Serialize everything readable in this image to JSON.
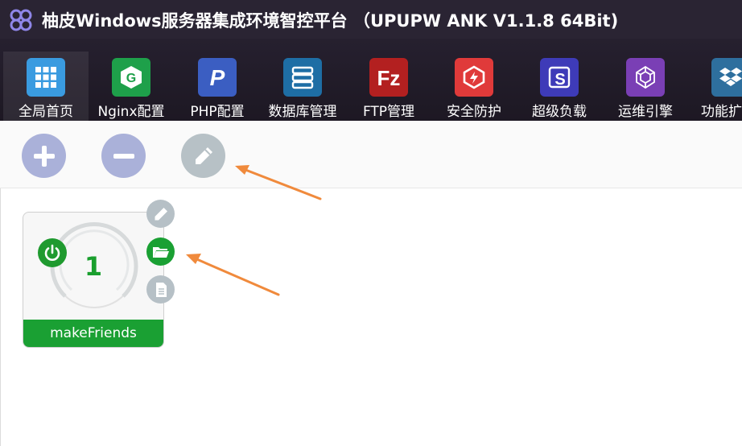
{
  "window": {
    "title": "柚皮Windows服务器集成环境智控平台 （UPUPW ANK V1.1.8 64Bit)"
  },
  "toolbar": {
    "items": [
      {
        "label": "全局首页",
        "icon": "grid-icon",
        "color": "#3a9be0"
      },
      {
        "label": "Nginx配置",
        "icon": "nginx-icon",
        "color": "#1ea04a"
      },
      {
        "label": "PHP配置",
        "icon": "php-icon",
        "color": "#3b5ec2"
      },
      {
        "label": "数据库管理",
        "icon": "database-icon",
        "color": "#1e6ea5"
      },
      {
        "label": "FTP管理",
        "icon": "filezilla-icon",
        "color": "#b32020"
      },
      {
        "label": "安全防护",
        "icon": "shield-icon",
        "color": "#e03a3a"
      },
      {
        "label": "超级负载",
        "icon": "load-icon",
        "color": "#3e3bb8"
      },
      {
        "label": "运维引擎",
        "icon": "engine-icon",
        "color": "#7a3fb5"
      },
      {
        "label": "功能扩",
        "icon": "dropbox-icon",
        "color": "#2e6f9e"
      }
    ]
  },
  "actions": {
    "add_icon": "plus-icon",
    "remove_icon": "minus-icon",
    "edit_icon": "pencil-icon"
  },
  "site_card": {
    "count": "1",
    "name": "makeFriends",
    "status_icon": "power-icon",
    "side_buttons": [
      "pencil-icon",
      "folder-open-icon",
      "document-icon"
    ]
  },
  "colors": {
    "accent_green": "#1aa033",
    "titlebar": "#2a2433",
    "arrow": "#f08a3c"
  }
}
